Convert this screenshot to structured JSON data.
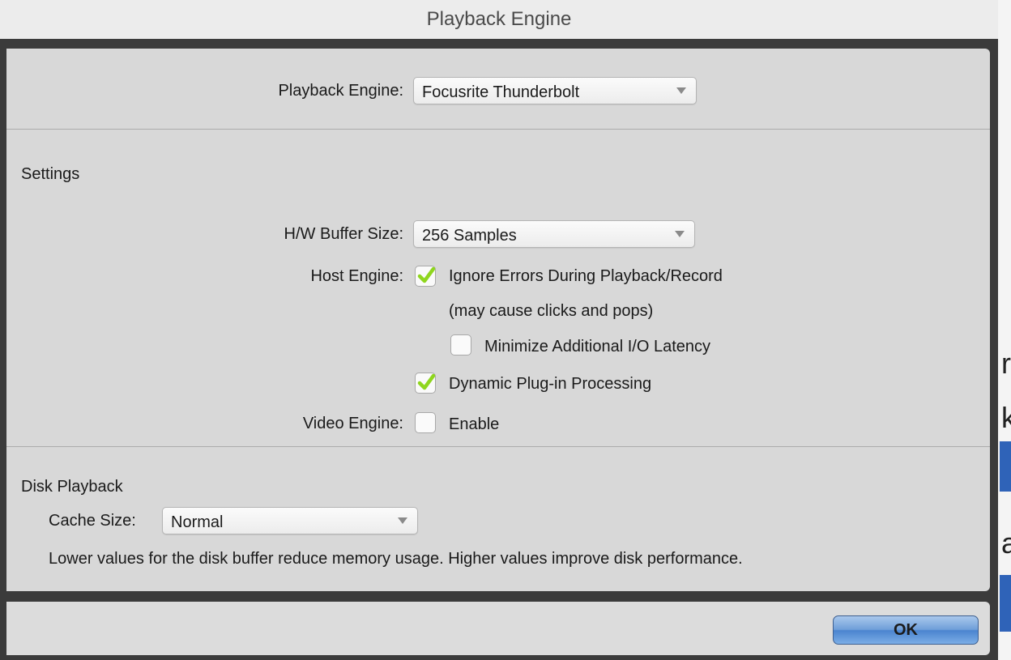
{
  "window": {
    "title": "Playback Engine"
  },
  "playback_engine": {
    "label": "Playback Engine:",
    "value": "Focusrite Thunderbolt"
  },
  "settings": {
    "title": "Settings",
    "buffer": {
      "label": "H/W Buffer Size:",
      "value": "256 Samples"
    },
    "host_engine": {
      "label": "Host Engine:",
      "ignore_errors": {
        "label": "Ignore Errors During Playback/Record",
        "checked": true
      },
      "ignore_errors_note": "(may cause clicks and pops)",
      "minimize_latency": {
        "label": "Minimize Additional I/O Latency",
        "checked": false
      },
      "dynamic_plugin": {
        "label": "Dynamic Plug-in Processing",
        "checked": true
      }
    },
    "video_engine": {
      "label": "Video Engine:",
      "enable_label": "Enable",
      "checked": false
    }
  },
  "disk_playback": {
    "title": "Disk Playback",
    "cache": {
      "label": "Cache Size:",
      "value": "Normal"
    },
    "note": "Lower values for the disk buffer reduce memory usage.  Higher values improve disk performance."
  },
  "buttons": {
    "ok": "OK"
  },
  "background_fragments": [
    "r",
    "k",
    "a"
  ],
  "colors": {
    "checkmark": "#8fd61e",
    "ok_button": "#6f9fd9"
  },
  "icons": [
    "checkmark-icon",
    "chevron-down-icon"
  ]
}
